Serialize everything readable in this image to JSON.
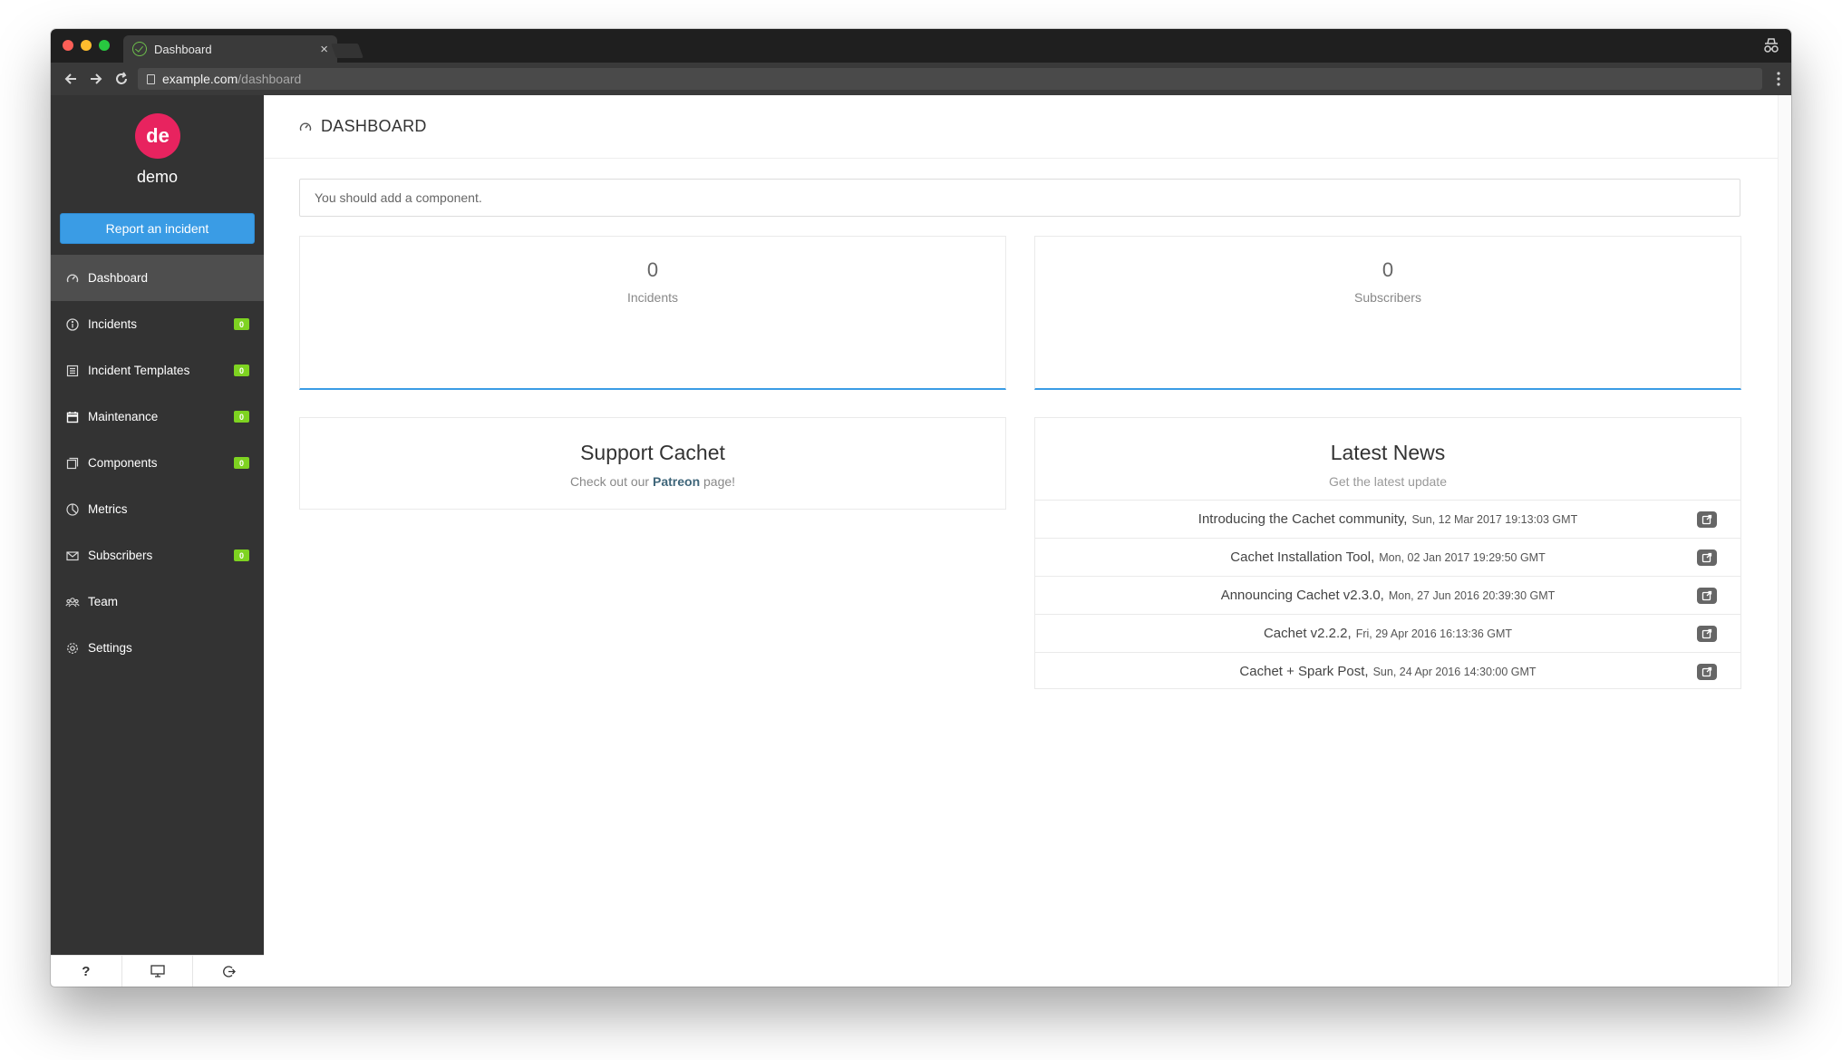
{
  "browser": {
    "tab_title": "Dashboard",
    "tab_close": "×",
    "url_host": "example.com",
    "url_path": "/dashboard"
  },
  "sidebar": {
    "avatar_initials": "de",
    "username": "demo",
    "report_button": "Report an incident",
    "items": [
      {
        "label": "Dashboard",
        "icon": "dashboard-icon",
        "badge": null,
        "active": true
      },
      {
        "label": "Incidents",
        "icon": "info-icon",
        "badge": "0"
      },
      {
        "label": "Incident Templates",
        "icon": "template-icon",
        "badge": "0"
      },
      {
        "label": "Maintenance",
        "icon": "calendar-icon",
        "badge": "0"
      },
      {
        "label": "Components",
        "icon": "components-icon",
        "badge": "0"
      },
      {
        "label": "Metrics",
        "icon": "pie-chart-icon",
        "badge": null
      },
      {
        "label": "Subscribers",
        "icon": "envelope-icon",
        "badge": "0"
      },
      {
        "label": "Team",
        "icon": "team-icon",
        "badge": null
      },
      {
        "label": "Settings",
        "icon": "gear-icon",
        "badge": null
      }
    ],
    "footer": {
      "help": "?",
      "status_page_icon": "monitor-icon",
      "logout_icon": "logout-icon"
    }
  },
  "main": {
    "header_title": "DASHBOARD",
    "alert": "You should add a component.",
    "stats": [
      {
        "value": "0",
        "label": "Incidents"
      },
      {
        "value": "0",
        "label": "Subscribers"
      }
    ],
    "support": {
      "title": "Support Cachet",
      "text_before": "Check out our ",
      "link": "Patreon",
      "text_after": " page!"
    },
    "news": {
      "title": "Latest News",
      "subtitle": "Get the latest update",
      "items": [
        {
          "title": "Introducing the Cachet community,",
          "date": "Sun, 12 Mar 2017 19:13:03 GMT"
        },
        {
          "title": "Cachet Installation Tool,",
          "date": "Mon, 02 Jan 2017 19:29:50 GMT"
        },
        {
          "title": "Announcing Cachet v2.3.0,",
          "date": "Mon, 27 Jun 2016 20:39:30 GMT"
        },
        {
          "title": "Cachet v2.2.2,",
          "date": "Fri, 29 Apr 2016 16:13:36 GMT"
        },
        {
          "title": "Cachet + Spark Post,",
          "date": "Sun, 24 Apr 2016 14:30:00 GMT"
        }
      ]
    }
  },
  "colors": {
    "sidebar_bg": "#333333",
    "accent": "#3a9ce5",
    "avatar": "#e8235f",
    "badge": "#7ed321"
  }
}
